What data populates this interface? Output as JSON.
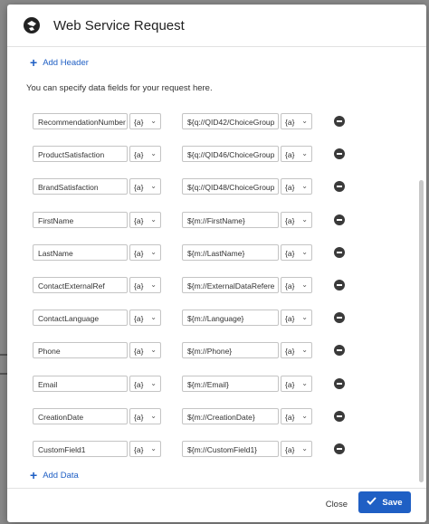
{
  "modal": {
    "title": "Web Service Request",
    "add_header_label": "Add Header",
    "intro_text": "You can specify data fields for your request here.",
    "add_data_label": "Add Data",
    "piped_label": "{a}",
    "close_label": "Close",
    "save_label": "Save"
  },
  "fields": [
    {
      "name": "RecommendationNumber",
      "value": "${q://QID42/ChoiceGroup"
    },
    {
      "name": "ProductSatisfaction",
      "value": "${q://QID46/ChoiceGroup"
    },
    {
      "name": "BrandSatisfaction",
      "value": "${q://QID48/ChoiceGroup"
    },
    {
      "name": "FirstName",
      "value": "${m://FirstName}"
    },
    {
      "name": "LastName",
      "value": "${m://LastName}"
    },
    {
      "name": "ContactExternalRef",
      "value": "${m://ExternalDataRefere"
    },
    {
      "name": "ContactLanguage",
      "value": "${m://Language}"
    },
    {
      "name": "Phone",
      "value": "${m://Phone}"
    },
    {
      "name": "Email",
      "value": "${m://Email}"
    },
    {
      "name": "CreationDate",
      "value": "${m://CreationDate}"
    },
    {
      "name": "CustomField1",
      "value": "${m://CustomField1}"
    }
  ],
  "colors": {
    "accent": "#1f5fc4",
    "overlay": "#8a8a8a"
  }
}
